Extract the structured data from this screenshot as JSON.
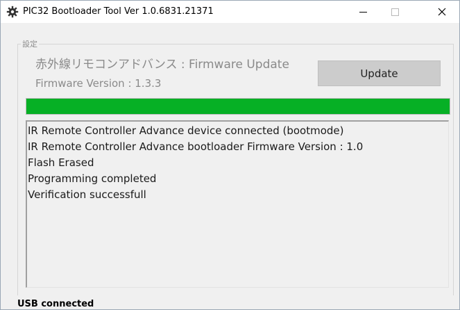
{
  "window": {
    "title": "PIC32 Bootloader Tool Ver 1.0.6831.21371",
    "icon": "gear-icon",
    "controls": {
      "minimize": "minimize-icon",
      "maximize": "maximize-icon",
      "close_label": "✕"
    }
  },
  "settings": {
    "legend": "設定",
    "title": "赤外線リモコンアドバンス : Firmware Update",
    "firmware_version": "Firmware Version : 1.3.3",
    "update_label": "Update"
  },
  "progress": {
    "percent": 100,
    "color": "#06b025"
  },
  "log": {
    "lines": [
      "IR Remote Controller Advance device connected (bootmode)",
      "IR Remote Controller Advance bootloader Firmware Version : 1.0",
      "Flash Erased",
      "Programming completed",
      "Verification successfull"
    ]
  },
  "status": {
    "text": "USB connected"
  }
}
